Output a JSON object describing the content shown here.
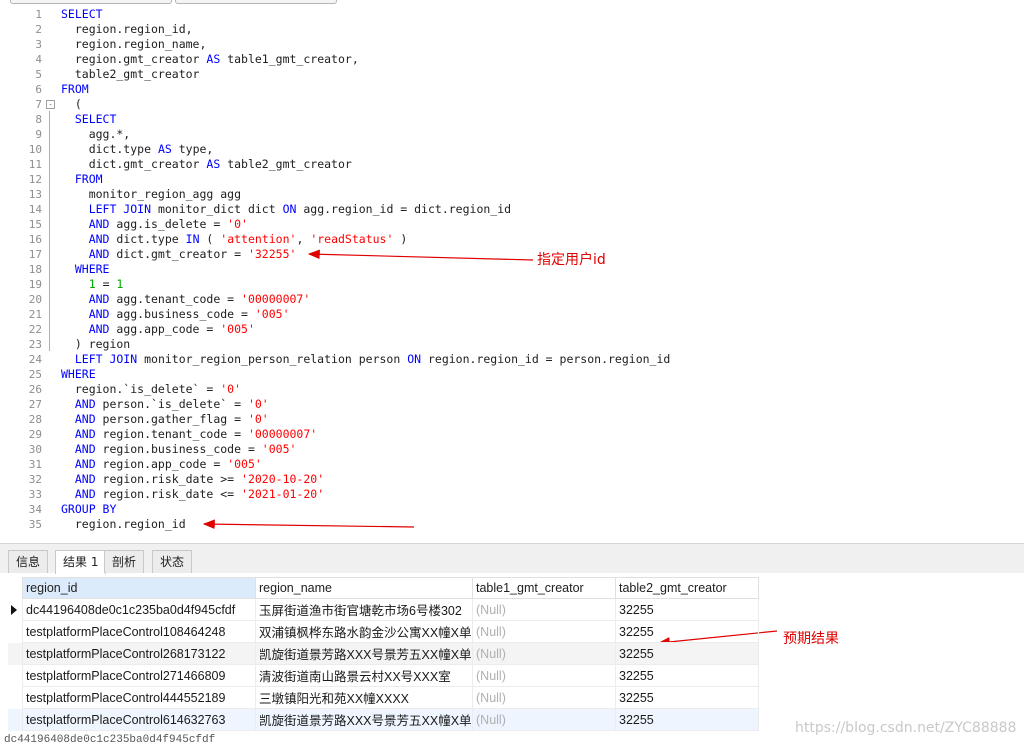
{
  "editor": {
    "lines": [
      {
        "n": "1",
        "tokens": [
          {
            "t": "SELECT",
            "c": "kw"
          }
        ]
      },
      {
        "n": "2",
        "tokens": [
          {
            "t": "  region.region_id,",
            "c": ""
          }
        ]
      },
      {
        "n": "3",
        "tokens": [
          {
            "t": "  region.region_name,",
            "c": ""
          }
        ]
      },
      {
        "n": "4",
        "tokens": [
          {
            "t": "  region.gmt_creator ",
            "c": ""
          },
          {
            "t": "AS",
            "c": "kw"
          },
          {
            "t": " table1_gmt_creator,",
            "c": ""
          }
        ]
      },
      {
        "n": "5",
        "tokens": [
          {
            "t": "  table2_gmt_creator",
            "c": ""
          }
        ]
      },
      {
        "n": "6",
        "tokens": [
          {
            "t": "FROM",
            "c": "kw"
          }
        ]
      },
      {
        "n": "7",
        "tokens": [
          {
            "t": "  (",
            "c": ""
          }
        ],
        "fold": "-"
      },
      {
        "n": "8",
        "tokens": [
          {
            "t": "  SELECT",
            "c": "kw"
          }
        ]
      },
      {
        "n": "9",
        "tokens": [
          {
            "t": "    agg.*,",
            "c": ""
          }
        ]
      },
      {
        "n": "10",
        "tokens": [
          {
            "t": "    dict.type ",
            "c": ""
          },
          {
            "t": "AS",
            "c": "kw"
          },
          {
            "t": " type,",
            "c": ""
          }
        ]
      },
      {
        "n": "11",
        "tokens": [
          {
            "t": "    dict.gmt_creator ",
            "c": ""
          },
          {
            "t": "AS",
            "c": "kw"
          },
          {
            "t": " table2_gmt_creator",
            "c": ""
          }
        ]
      },
      {
        "n": "12",
        "tokens": [
          {
            "t": "  FROM",
            "c": "kw"
          }
        ]
      },
      {
        "n": "13",
        "tokens": [
          {
            "t": "    monitor_region_agg agg",
            "c": ""
          }
        ]
      },
      {
        "n": "14",
        "tokens": [
          {
            "t": "    LEFT JOIN",
            "c": "kw"
          },
          {
            "t": " monitor_dict dict ",
            "c": ""
          },
          {
            "t": "ON",
            "c": "kw"
          },
          {
            "t": " agg.region_id = dict.region_id",
            "c": ""
          }
        ]
      },
      {
        "n": "15",
        "tokens": [
          {
            "t": "    AND",
            "c": "kw"
          },
          {
            "t": " agg.is_delete = ",
            "c": ""
          },
          {
            "t": "'0'",
            "c": "str"
          }
        ]
      },
      {
        "n": "16",
        "tokens": [
          {
            "t": "    AND",
            "c": "kw"
          },
          {
            "t": " dict.type ",
            "c": ""
          },
          {
            "t": "IN",
            "c": "kw"
          },
          {
            "t": " ( ",
            "c": ""
          },
          {
            "t": "'attention'",
            "c": "str"
          },
          {
            "t": ", ",
            "c": ""
          },
          {
            "t": "'readStatus'",
            "c": "str"
          },
          {
            "t": " )",
            "c": ""
          }
        ]
      },
      {
        "n": "17",
        "tokens": [
          {
            "t": "    AND",
            "c": "kw"
          },
          {
            "t": " dict.gmt_creator = ",
            "c": ""
          },
          {
            "t": "'32255'",
            "c": "str"
          }
        ]
      },
      {
        "n": "18",
        "tokens": [
          {
            "t": "  WHERE",
            "c": "kw"
          }
        ]
      },
      {
        "n": "19",
        "tokens": [
          {
            "t": "    ",
            "c": ""
          },
          {
            "t": "1",
            "c": "num"
          },
          {
            "t": " = ",
            "c": ""
          },
          {
            "t": "1",
            "c": "num"
          }
        ]
      },
      {
        "n": "20",
        "tokens": [
          {
            "t": "    AND",
            "c": "kw"
          },
          {
            "t": " agg.tenant_code = ",
            "c": ""
          },
          {
            "t": "'00000007'",
            "c": "str"
          }
        ]
      },
      {
        "n": "21",
        "tokens": [
          {
            "t": "    AND",
            "c": "kw"
          },
          {
            "t": " agg.business_code = ",
            "c": ""
          },
          {
            "t": "'005'",
            "c": "str"
          }
        ]
      },
      {
        "n": "22",
        "tokens": [
          {
            "t": "    AND",
            "c": "kw"
          },
          {
            "t": " agg.app_code = ",
            "c": ""
          },
          {
            "t": "'005'",
            "c": "str"
          }
        ]
      },
      {
        "n": "23",
        "tokens": [
          {
            "t": "  ) region",
            "c": ""
          }
        ]
      },
      {
        "n": "24",
        "tokens": [
          {
            "t": "  LEFT JOIN",
            "c": "kw"
          },
          {
            "t": " monitor_region_person_relation person ",
            "c": ""
          },
          {
            "t": "ON",
            "c": "kw"
          },
          {
            "t": " region.region_id = person.region_id",
            "c": ""
          }
        ]
      },
      {
        "n": "25",
        "tokens": [
          {
            "t": "WHERE",
            "c": "kw"
          }
        ]
      },
      {
        "n": "26",
        "tokens": [
          {
            "t": "  region.`is_delete` = ",
            "c": ""
          },
          {
            "t": "'0'",
            "c": "str"
          }
        ]
      },
      {
        "n": "27",
        "tokens": [
          {
            "t": "  AND",
            "c": "kw"
          },
          {
            "t": " person.`is_delete` = ",
            "c": ""
          },
          {
            "t": "'0'",
            "c": "str"
          }
        ]
      },
      {
        "n": "28",
        "tokens": [
          {
            "t": "  AND",
            "c": "kw"
          },
          {
            "t": " person.gather_flag = ",
            "c": ""
          },
          {
            "t": "'0'",
            "c": "str"
          }
        ]
      },
      {
        "n": "29",
        "tokens": [
          {
            "t": "  AND",
            "c": "kw"
          },
          {
            "t": " region.tenant_code = ",
            "c": ""
          },
          {
            "t": "'00000007'",
            "c": "str"
          }
        ]
      },
      {
        "n": "30",
        "tokens": [
          {
            "t": "  AND",
            "c": "kw"
          },
          {
            "t": " region.business_code = ",
            "c": ""
          },
          {
            "t": "'005'",
            "c": "str"
          }
        ]
      },
      {
        "n": "31",
        "tokens": [
          {
            "t": "  AND",
            "c": "kw"
          },
          {
            "t": " region.app_code = ",
            "c": ""
          },
          {
            "t": "'005'",
            "c": "str"
          }
        ]
      },
      {
        "n": "32",
        "tokens": [
          {
            "t": "  AND",
            "c": "kw"
          },
          {
            "t": " region.risk_date >= ",
            "c": ""
          },
          {
            "t": "'2020-10-20'",
            "c": "str"
          }
        ]
      },
      {
        "n": "33",
        "tokens": [
          {
            "t": "  AND",
            "c": "kw"
          },
          {
            "t": " region.risk_date <= ",
            "c": ""
          },
          {
            "t": "'2021-01-20'",
            "c": "str"
          }
        ]
      },
      {
        "n": "34",
        "tokens": [
          {
            "t": "GROUP BY",
            "c": "kw"
          }
        ]
      },
      {
        "n": "35",
        "tokens": [
          {
            "t": "  region.region_id",
            "c": ""
          }
        ]
      }
    ]
  },
  "annotations": {
    "user_id_note": "指定用户id",
    "expected_note": "预期结果"
  },
  "tabs": [
    {
      "label": "信息",
      "active": false
    },
    {
      "label": "结果 1",
      "active": true
    },
    {
      "label": "剖析",
      "active": false
    },
    {
      "label": "状态",
      "active": false
    }
  ],
  "results": {
    "columns": [
      "region_id",
      "region_name",
      "table1_gmt_creator",
      "table2_gmt_creator"
    ],
    "rows": [
      [
        "dc44196408de0c1c235ba0d4f945cfdf",
        "玉屏街道渔市街官塘乾市场6号楼302",
        "(Null)",
        "32255"
      ],
      [
        "testplatformPlaceControl108464248",
        "双浦镇枫桦东路水韵金沙公寓XX幢X单元",
        "(Null)",
        "32255"
      ],
      [
        "testplatformPlaceControl268173122",
        "凯旋街道景芳路XXX号景芳五XX幢X单元",
        "(Null)",
        "32255"
      ],
      [
        "testplatformPlaceControl271466809",
        "清波街道南山路景云村XX号XXX室",
        "(Null)",
        "32255"
      ],
      [
        "testplatformPlaceControl444552189",
        "三墩镇阳光和苑XX幢XXXX",
        "(Null)",
        "32255"
      ],
      [
        "testplatformPlaceControl614632763",
        "凯旋街道景芳路XXX号景芳五XX幢X单元",
        "(Null)",
        "32255"
      ]
    ]
  },
  "bottom_text": "dc44196408de0c1c235ba0d4f945cfdf",
  "watermark": "https://blog.csdn.net/ZYC88888",
  "colors": {
    "keyword": "#0000ff",
    "string": "#ff0000",
    "number": "#00aa00",
    "annotation": "#e00000"
  }
}
